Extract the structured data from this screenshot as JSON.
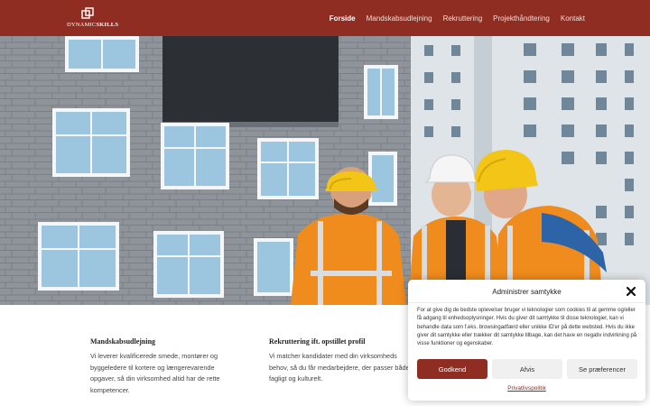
{
  "header": {
    "logo_text_a": "DYNAMIC",
    "logo_text_b": "SKILLS",
    "nav": [
      {
        "label": "Forside",
        "active": true
      },
      {
        "label": "Mandskabsudlejning"
      },
      {
        "label": "Rekruttering"
      },
      {
        "label": "Projekthåndtering"
      },
      {
        "label": "Kontakt"
      }
    ]
  },
  "hero": {
    "image": "construction-workers-with-hardhats-photo"
  },
  "services": [
    {
      "title": "Mandskabsudlejning",
      "text": "Vi leverer kvalificerede smede, montører og byggeledere til kortere og længerevarende opgaver, så din virksomhed altid har de rette kompetencer."
    },
    {
      "title": "Rekruttering ift. opstillet profil",
      "text": "Vi matcher kandidater med din virksomheds behov, så du får medarbejdere, der passer både fagligt og kulturelt."
    }
  ],
  "consent": {
    "title": "Administrer samtykke",
    "text": "For at give dig de bedste oplevelser bruger vi teknologier som cookies til at gemme og/eller få adgang til enhedsoplysninger. Hvis du giver dit samtykke til disse teknologier, kan vi behandle data som f.eks. browsingadfærd eller unikke ID'er på dette websted. Hvis du ikke giver dit samtykke eller trækker dit samtykke tilbage, kan det have en negativ indvirkning på visse funktioner og egenskaber.",
    "accept": "Godkend",
    "deny": "Afvis",
    "preferences": "Se præferencer",
    "policy_link": "Privatlivspolitik"
  },
  "colors": {
    "brand": "#8f2d22",
    "button_secondary": "#f0f0f0"
  }
}
